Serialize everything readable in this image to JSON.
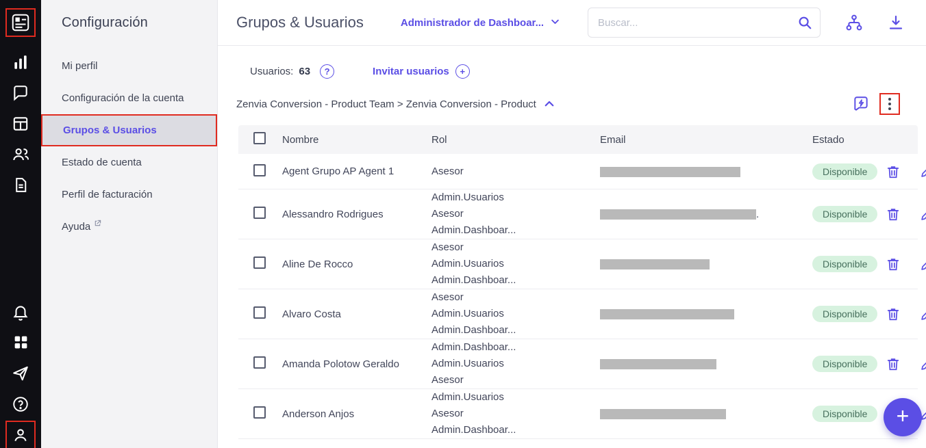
{
  "colors": {
    "accent": "#5b4ee5",
    "pill_bg": "#d7f2df",
    "pill_text": "#47705d",
    "annotation": "#e02b20"
  },
  "left_rail": {
    "icons": [
      "zenvia-logo",
      "bar-chart-icon",
      "chat-icon",
      "data-table-icon",
      "users-group-icon",
      "document-icon",
      "bell-icon",
      "apps-grid-icon",
      "send-icon",
      "help-icon",
      "profile-icon"
    ]
  },
  "sidebar": {
    "title": "Configuración",
    "items": [
      {
        "label": "Mi perfil"
      },
      {
        "label": "Configuración de la cuenta"
      },
      {
        "label": "Grupos & Usuarios",
        "active": true,
        "annotated": true
      },
      {
        "label": "Estado de cuenta"
      },
      {
        "label": "Perfil de facturación"
      },
      {
        "label": "Ayuda",
        "external": true
      }
    ]
  },
  "header": {
    "title": "Grupos & Usuarios",
    "role_selector": "Administrador de Dashboar...",
    "search_placeholder": "Buscar..."
  },
  "toolbar": {
    "users_label": "Usuarios:",
    "users_count": "63",
    "help_glyph": "?",
    "invite_label": "Invitar usuarios",
    "plus_glyph": "+"
  },
  "breadcrumb": {
    "path": "Zenvia Conversion - Product Team > Zenvia Conversion - Product"
  },
  "table": {
    "headers": [
      "Nombre",
      "Rol",
      "Email",
      "Estado"
    ],
    "rows": [
      {
        "name": "Agent Grupo AP Agent 1",
        "roles": [
          "Asesor"
        ],
        "estado": "Disponible",
        "email_redacted_width": 205
      },
      {
        "name": "Alessandro Rodrigues",
        "roles": [
          "Admin.Usuarios",
          "Asesor",
          "Admin.Dashboar..."
        ],
        "estado": "Disponible",
        "email_redacted_width": 228,
        "email_suffix": "."
      },
      {
        "name": "Aline De Rocco",
        "roles": [
          "Asesor",
          "Admin.Usuarios",
          "Admin.Dashboar..."
        ],
        "estado": "Disponible",
        "email_redacted_width": 160
      },
      {
        "name": "Alvaro Costa",
        "roles": [
          "Asesor",
          "Admin.Usuarios",
          "Admin.Dashboar..."
        ],
        "estado": "Disponible",
        "email_redacted_width": 196
      },
      {
        "name": "Amanda Polotow Geraldo",
        "roles": [
          "Admin.Dashboar...",
          "Admin.Usuarios",
          "Asesor"
        ],
        "estado": "Disponible",
        "email_redacted_width": 170
      },
      {
        "name": "Anderson Anjos",
        "roles": [
          "Admin.Usuarios",
          "Asesor",
          "Admin.Dashboar..."
        ],
        "estado": "Disponible",
        "email_redacted_width": 184
      }
    ]
  },
  "fab": {
    "label": "+"
  }
}
